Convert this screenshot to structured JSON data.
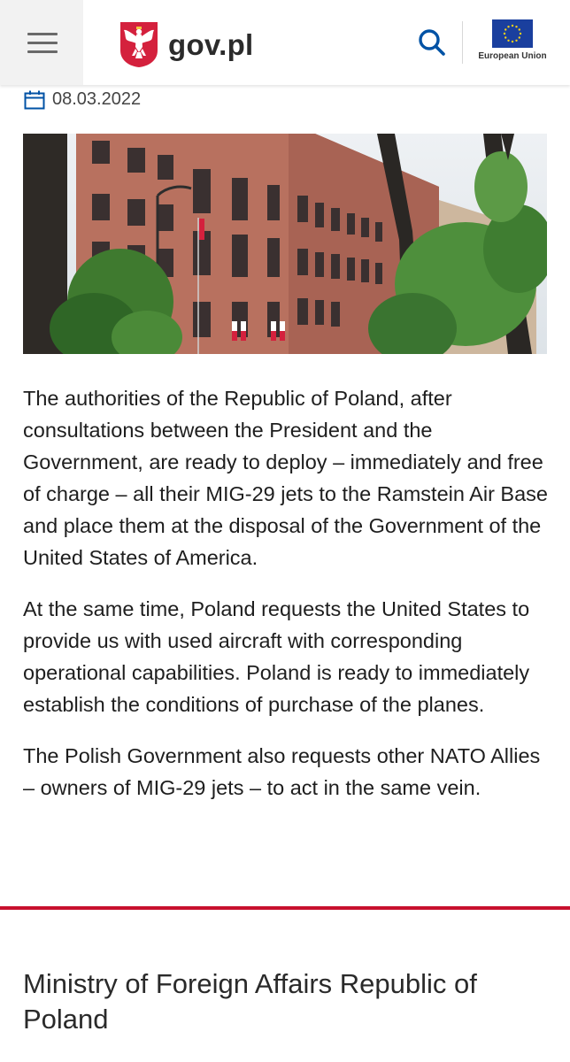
{
  "header": {
    "logo_text": "gov.pl",
    "eu_label": "European Union",
    "menu_icon": "hamburger-menu-icon",
    "search_icon": "search-icon",
    "accent_color": "#0052a5"
  },
  "article": {
    "date": "08.03.2022",
    "date_icon": "calendar-icon",
    "paragraphs": [
      "The authorities of the Republic of Poland, after consultations between the President and the Government, are ready to deploy – immediately and free of charge – all their MIG-29 jets to the Ramstein Air Base and place them at the disposal of the Government of the United States of America.",
      "At the same time, Poland requests the United States to provide us with used aircraft with corresponding operational capabilities. Poland is ready to immediately establish the conditions of purchase of the planes.",
      "The Polish Government also requests other NATO Allies – owners of MIG-29 jets – to act in the same vein."
    ]
  },
  "footer": {
    "title": "Ministry of Foreign Affairs Republic of Poland",
    "rule_color": "#c8102e"
  }
}
